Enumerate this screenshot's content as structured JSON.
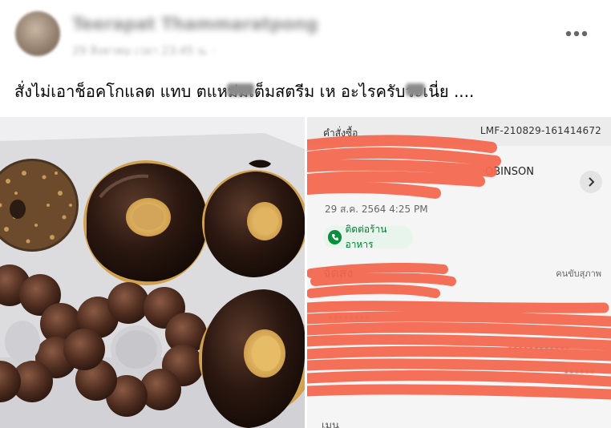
{
  "post": {
    "author_name": "Teerapat Thammaratpong",
    "timestamp": "29 สิงหาคม เวลา 23:45 น. · ",
    "text": "สั่งไม่เอาช็อคโกแลต แทบ ตแหม่มเต็มสตรีม เห อะไรครับวะเนี่ย ...."
  },
  "order": {
    "label": "คำสั่งซื้อ",
    "code": "LMF-210829-161414672",
    "store_name_fragment": "OBINSON",
    "date": "29 ส.ค. 2564 4:25 PM",
    "contact_label": "ติดต่อร้านอาหาร",
    "delivery_label": "จัดส่ง",
    "driver_label": "คนขับสุภาพ",
    "bottom_label": "เมน"
  },
  "icons": {
    "more": "more-horizontal-icon",
    "chevron": "chevron-right-icon",
    "phone": "phone-icon"
  },
  "colors": {
    "scribble": "#f4684f",
    "contact_green": "#0a8f3e"
  }
}
